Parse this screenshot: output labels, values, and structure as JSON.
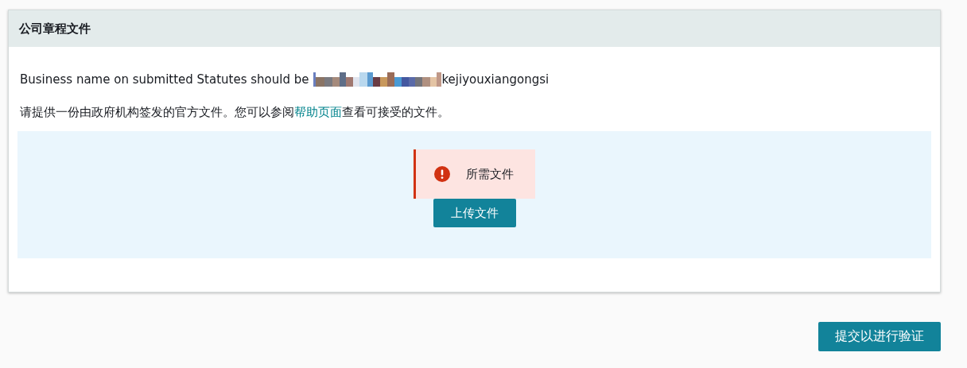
{
  "card": {
    "title": "公司章程文件",
    "business_name_note": {
      "text": "Business name on submitted Statutes should be",
      "name_suffix": "kejiyouxiangongsi"
    },
    "instructions": {
      "before_link": "请提供一份由政府机构签发的官方文件。您可以参阅",
      "link": "帮助页面",
      "after_link": "查看可接受的文件。"
    },
    "upload": {
      "alert": {
        "kind": "error",
        "text": "所需文件"
      },
      "button": "上传文件"
    }
  },
  "submit_button": "提交以进行验证"
}
